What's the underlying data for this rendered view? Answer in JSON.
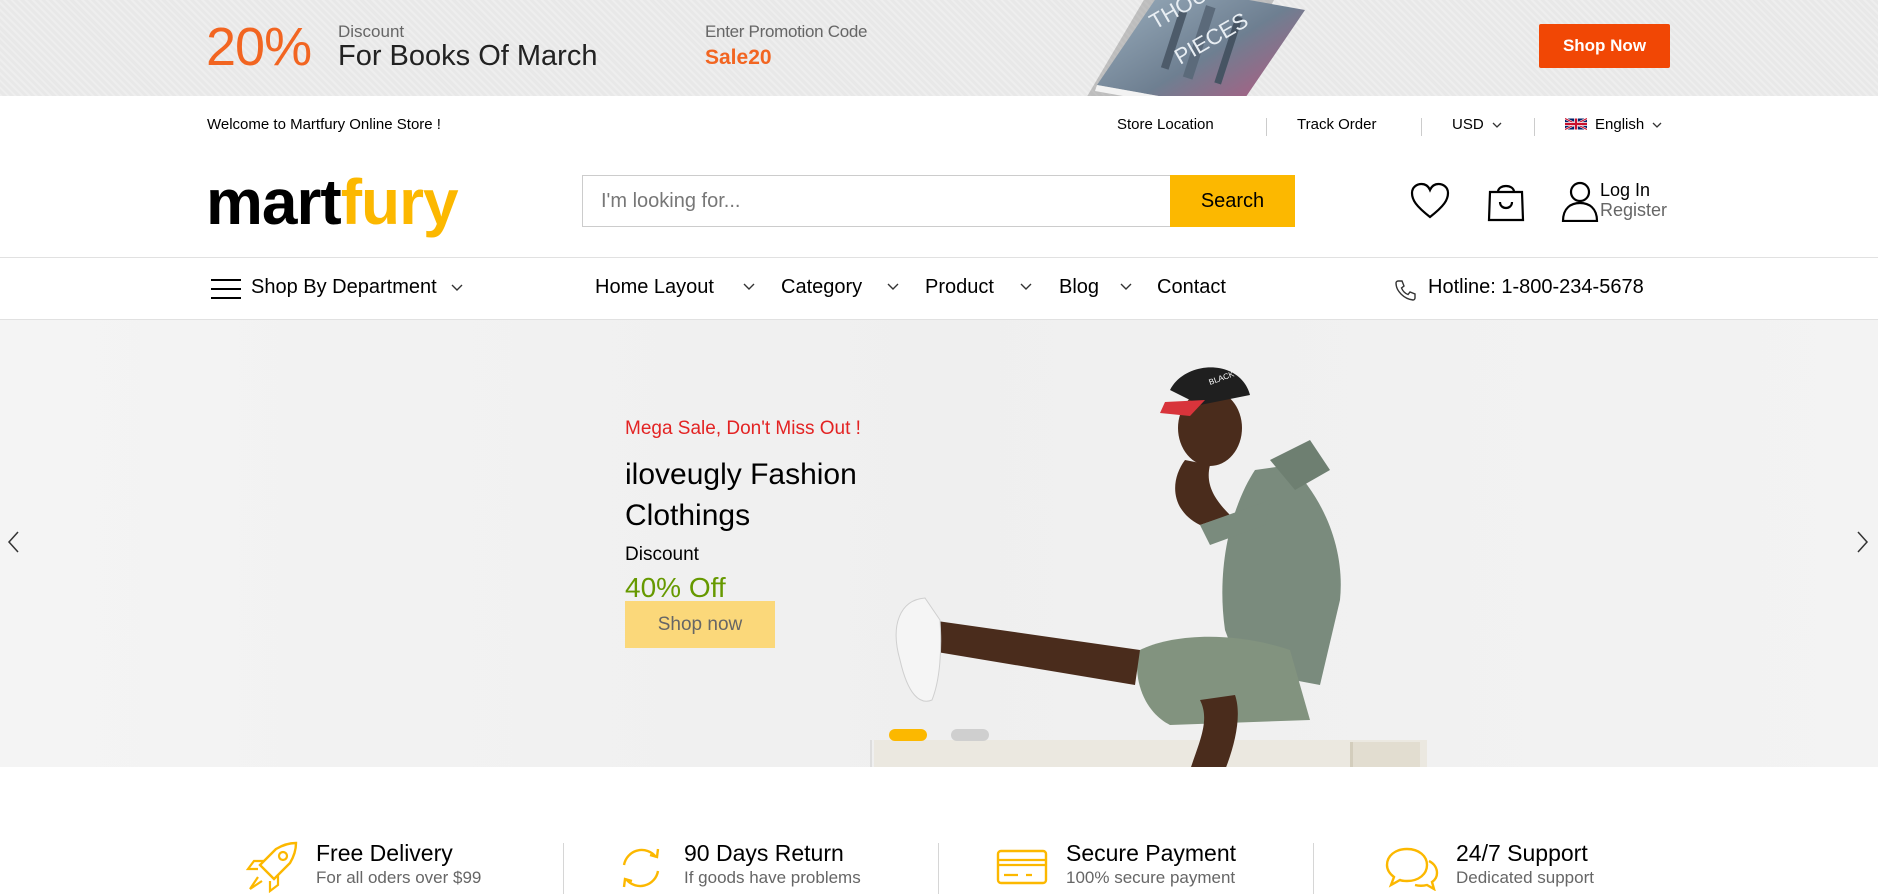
{
  "promo": {
    "percent": "20%",
    "discount_label": "Discount",
    "discount_text": "For Books Of March",
    "code_label": "Enter Promotion Code",
    "code_value": "Sale20",
    "button": "Shop Now",
    "accent": "#f26521",
    "button_color": "#f14705"
  },
  "topbar": {
    "welcome": "Welcome to Martfury Online Store !",
    "store_location": "Store Location",
    "track_order": "Track Order",
    "currency": "USD",
    "language": "English"
  },
  "header": {
    "logo_part1": "mart",
    "logo_part2": "fury",
    "search_placeholder": "I'm looking for...",
    "search_button": "Search",
    "login": "Log In",
    "register": "Register",
    "brand_color": "#fcb800",
    "icons": [
      "heart-icon",
      "shopping-bag-icon",
      "user-icon"
    ]
  },
  "nav": {
    "department": "Shop By Department",
    "items": [
      {
        "label": "Home Layout",
        "has_dropdown": true
      },
      {
        "label": "Category",
        "has_dropdown": true
      },
      {
        "label": "Product",
        "has_dropdown": true
      },
      {
        "label": "Blog",
        "has_dropdown": true
      },
      {
        "label": "Contact",
        "has_dropdown": false
      }
    ],
    "hotline": "Hotline: 1-800-234-5678"
  },
  "hero": {
    "tag": "Mega Sale, Don't Miss Out !",
    "title": "iloveugly Fashion Clothings",
    "discount_label": "Discount",
    "discount_value": "40% Off",
    "button": "Shop now",
    "slides": 2,
    "active_slide": 1,
    "tag_color": "#e32323",
    "value_color": "#669900"
  },
  "features": [
    {
      "icon": "rocket-icon",
      "title": "Free Delivery",
      "subtitle": "For all oders over $99"
    },
    {
      "icon": "refresh-icon",
      "title": "90 Days Return",
      "subtitle": "If goods have problems"
    },
    {
      "icon": "credit-card-icon",
      "title": "Secure Payment",
      "subtitle": "100% secure payment"
    },
    {
      "icon": "chat-icon",
      "title": "24/7 Support",
      "subtitle": "Dedicated support"
    }
  ]
}
